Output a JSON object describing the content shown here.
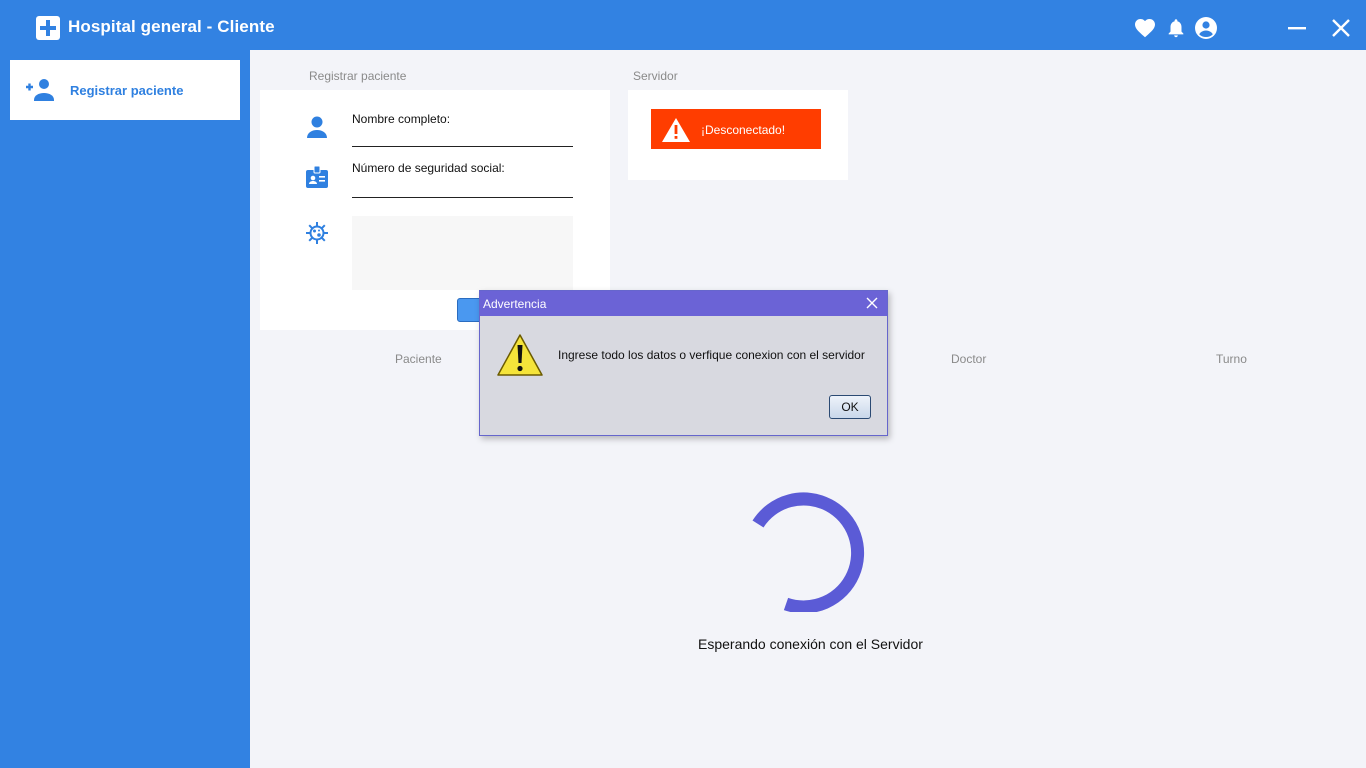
{
  "window": {
    "title": "Hospital general - Cliente"
  },
  "sidebar": {
    "items": [
      {
        "label": "Registrar paciente",
        "icon": "add-user-icon"
      }
    ]
  },
  "register": {
    "section_title": "Registrar paciente",
    "fields": [
      {
        "label": "Nombre completo:",
        "icon": "person-icon",
        "value": ""
      },
      {
        "label": "Número de seguridad social:",
        "icon": "id-badge-icon",
        "value": ""
      },
      {
        "label": "",
        "icon": "virus-icon",
        "value": ""
      }
    ],
    "submit_label": ""
  },
  "server": {
    "section_title": "Servidor",
    "status_text": "¡Desconectado!",
    "status_color": "#ff3d00"
  },
  "table": {
    "columns": [
      "Paciente",
      "Doctor",
      "Turno"
    ]
  },
  "loading": {
    "text": "Esperando conexión con el Servidor",
    "color": "#5b5bd6"
  },
  "dialog": {
    "title": "Advertencia",
    "message": "Ingrese todo los datos o verfique conexion con el servidor",
    "ok_label": "OK"
  },
  "colors": {
    "primary": "#3282e2",
    "dialog_header": "#6b63d6"
  }
}
